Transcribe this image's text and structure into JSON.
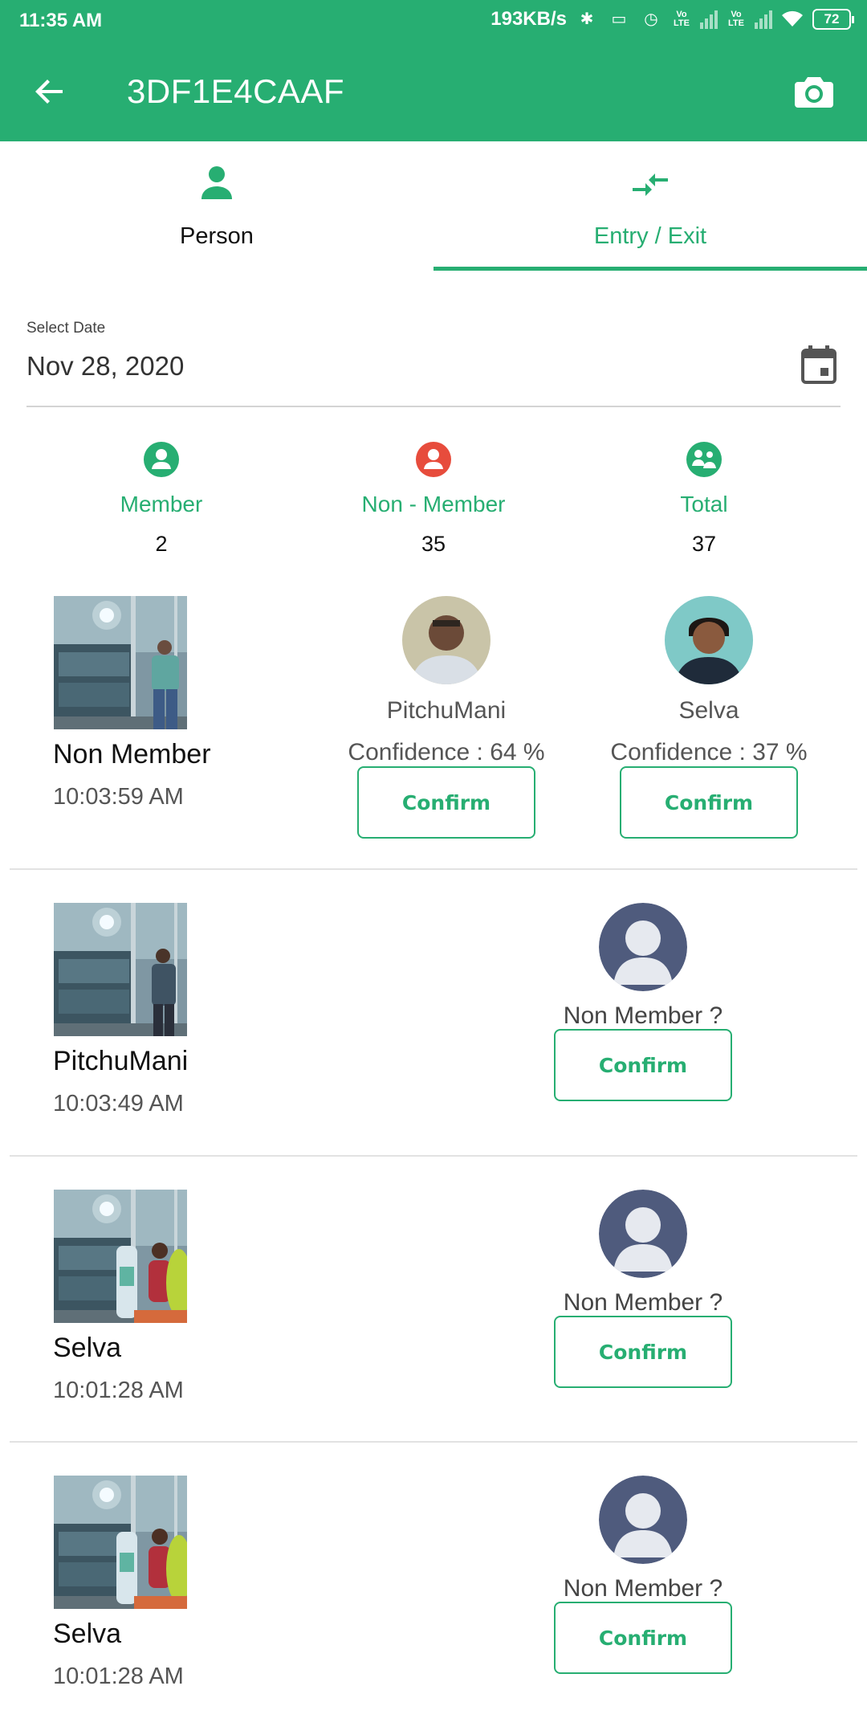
{
  "status_bar": {
    "time": "11:35 AM",
    "network_speed": "193KB/s",
    "battery": "72"
  },
  "app_bar": {
    "title": "3DF1E4CAAF"
  },
  "tabs": [
    {
      "label": "Person",
      "icon": "person-icon",
      "active": false
    },
    {
      "label": "Entry / Exit",
      "icon": "entry-exit-arrows-icon",
      "active": true
    }
  ],
  "date_picker": {
    "label": "Select Date",
    "value": "Nov 28, 2020"
  },
  "stats": [
    {
      "label": "Member",
      "count": "2",
      "color": "#27ae72"
    },
    {
      "label": "Non - Member",
      "count": "35",
      "color": "#e74c3c"
    },
    {
      "label": "Total",
      "count": "37",
      "color": "#27ae72"
    }
  ],
  "entries": [
    {
      "name": "Non Member",
      "time": "10:03:59 AM",
      "candidates": [
        {
          "name": "PitchuMani",
          "confidence": "Confidence : 64 %",
          "confirm": "Confirm"
        },
        {
          "name": "Selva",
          "confidence": "Confidence : 37 %",
          "confirm": "Confirm"
        }
      ]
    },
    {
      "name": "PitchuMani",
      "time": "10:03:49 AM",
      "suggestion": "Non Member ?",
      "confirm": "Confirm"
    },
    {
      "name": "Selva",
      "time": "10:01:28 AM",
      "suggestion": "Non Member ?",
      "confirm": "Confirm"
    },
    {
      "name": "Selva",
      "time": "10:01:28 AM",
      "suggestion": "Non Member ?",
      "confirm": "Confirm"
    }
  ],
  "colors": {
    "primary": "#27ae72",
    "danger": "#e74c3c",
    "avatar_bg": "#4f5b7d"
  }
}
